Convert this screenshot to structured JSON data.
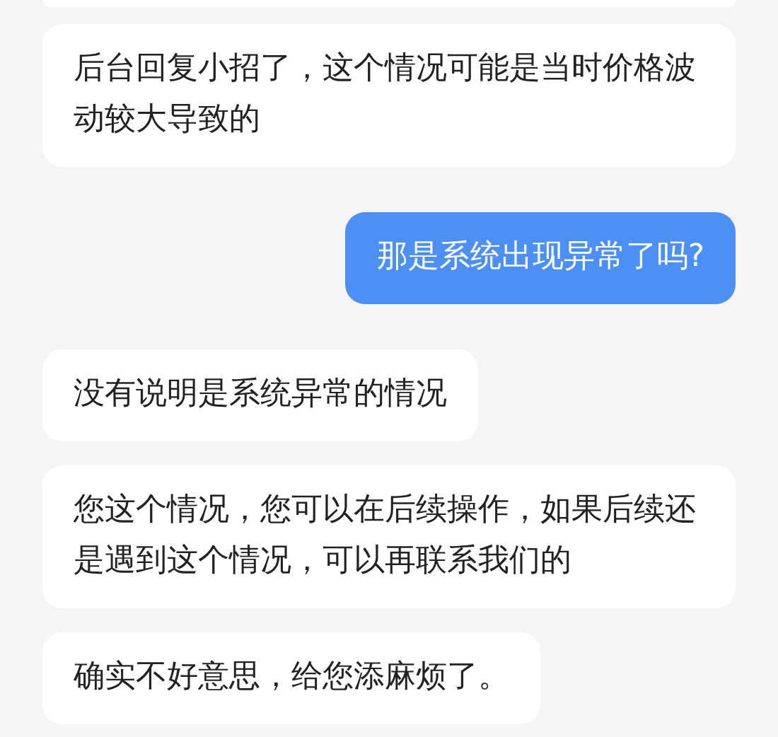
{
  "messages": [
    {
      "kind": "incoming",
      "text": "后台回复小招了，这个情况可能是当时价格波动较大导致的"
    },
    {
      "kind": "outgoing",
      "text": "那是系统出现异常了吗?"
    },
    {
      "kind": "incoming",
      "text": "没有说明是系统异常的情况"
    },
    {
      "kind": "incoming",
      "text": "您这个情况，您可以在后续操作，如果后续还是遇到这个情况，可以再联系我们的"
    },
    {
      "kind": "incoming",
      "text": "确实不好意思，给您添麻烦了。"
    }
  ]
}
